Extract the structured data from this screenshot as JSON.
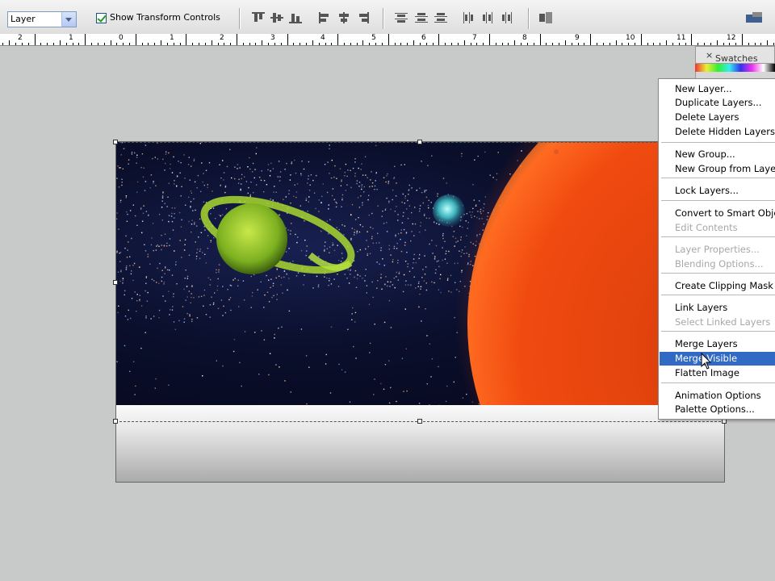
{
  "options_bar": {
    "auto_select_value": "Layer",
    "show_transform_label": "Show Transform Controls",
    "show_transform_checked": true
  },
  "ruler": {
    "labels": [
      "2",
      "1",
      "0",
      "1",
      "2",
      "3",
      "4",
      "5",
      "6",
      "7",
      "8",
      "9",
      "10",
      "11",
      "12"
    ]
  },
  "panel": {
    "swatches_tab": "Swatches",
    "close_glyph": "×"
  },
  "context_menu": {
    "items": [
      {
        "label": "New Layer...",
        "enabled": true
      },
      {
        "label": "Duplicate Layers...",
        "enabled": true
      },
      {
        "label": "Delete Layers",
        "enabled": true
      },
      {
        "label": "Delete Hidden Layers",
        "enabled": true
      },
      {
        "label": "New Group...",
        "enabled": true
      },
      {
        "label": "New Group from Layers...",
        "enabled": true
      },
      {
        "label": "Lock Layers...",
        "enabled": true
      },
      {
        "label": "Convert to Smart Object",
        "enabled": true
      },
      {
        "label": "Edit Contents",
        "enabled": false
      },
      {
        "label": "Layer Properties...",
        "enabled": false
      },
      {
        "label": "Blending Options...",
        "enabled": false
      },
      {
        "label": "Create Clipping Mask",
        "enabled": true
      },
      {
        "label": "Link Layers",
        "enabled": true
      },
      {
        "label": "Select Linked Layers",
        "enabled": false
      },
      {
        "label": "Merge Layers",
        "enabled": true
      },
      {
        "label": "Merge Visible",
        "enabled": true,
        "highlighted": true
      },
      {
        "label": "Flatten Image",
        "enabled": true
      },
      {
        "label": "Animation Options",
        "enabled": true
      },
      {
        "label": "Palette Options...",
        "enabled": true
      }
    ]
  },
  "colors": {
    "menu_highlight": "#316ac5",
    "workspace": "#c8c9c9"
  }
}
